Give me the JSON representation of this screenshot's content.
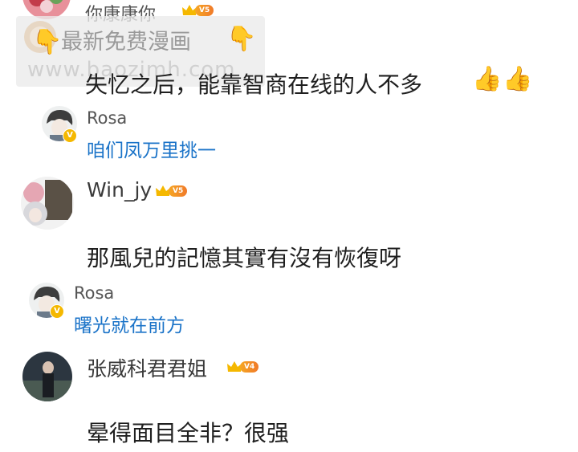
{
  "comments": [
    {
      "username": "你康康你",
      "level": "V5",
      "text": "失忆之后，能靠智商在线的人不多",
      "emoji": [
        "👍",
        "👍"
      ]
    },
    {
      "username": "Win_jy",
      "level": "V5",
      "text": "那風兒的記憶其實有沒有恢復呀"
    },
    {
      "username": "张威科君君姐",
      "level": "V4",
      "text": "晕得面目全非？很强"
    }
  ],
  "replies": [
    {
      "username": "Rosa",
      "badge": "V",
      "text": "咱们凤万里挑一"
    },
    {
      "username": "Rosa",
      "badge": "V",
      "text": "曙光就在前方"
    }
  ],
  "watermark": {
    "title": "最新免费漫画",
    "url": "www.baozimh.com",
    "hand_emoji": "👇"
  },
  "colors": {
    "reply_text": "#1a73c8",
    "username": "#555555",
    "level_badge": "#f6a623",
    "v_badge": "#f5b800"
  },
  "icons": {
    "level_badge_icon": "crown-icon",
    "verified_badge_icon": "v-badge-icon",
    "reaction": "thumbs-up-emoji"
  }
}
